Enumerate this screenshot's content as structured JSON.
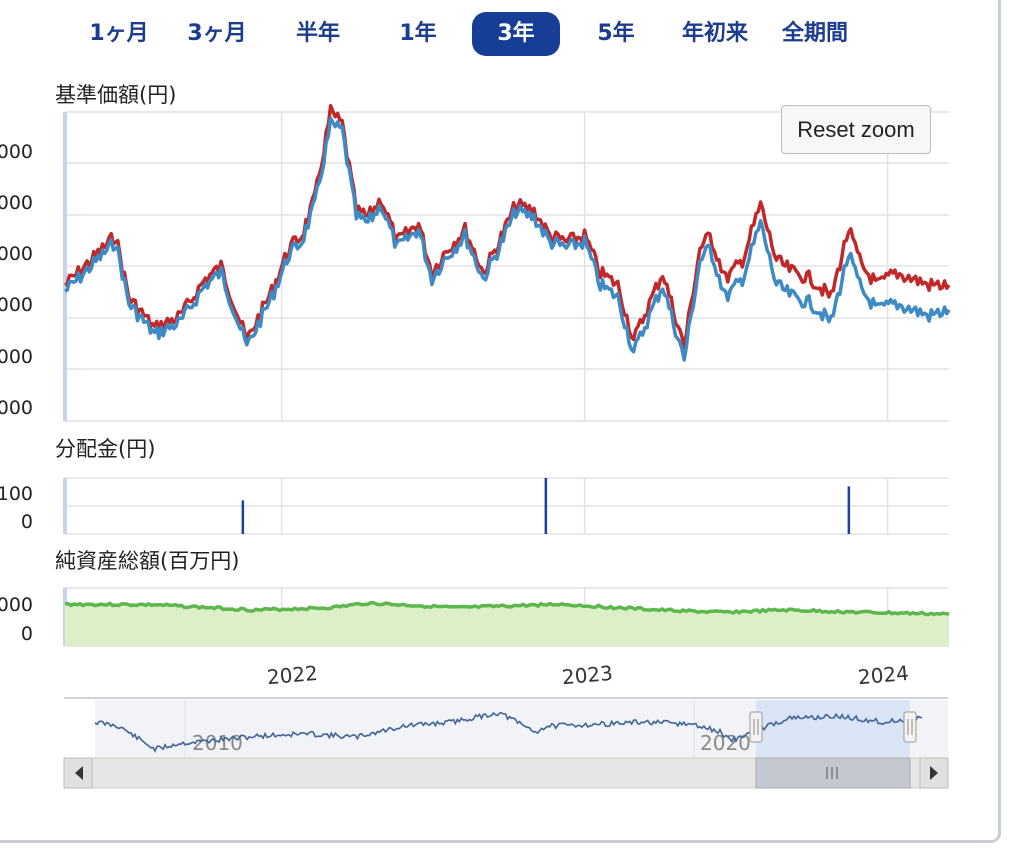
{
  "tabs": {
    "items": [
      "1ヶ月",
      "3ヶ月",
      "半年",
      "1年",
      "3年",
      "5年",
      "年初来",
      "全期間"
    ],
    "active": "3年"
  },
  "reset_zoom_label": "Reset zoom",
  "colors": {
    "price_red": "#c0282a",
    "price_blue": "#3d8ac5",
    "dividend_bar": "#1c3fa0",
    "assets_line": "#5cb84c",
    "assets_fill": "#dcefc8",
    "navigator_line": "#3f6596",
    "navigator_selection": "#d3e0f5",
    "tab_active": "#173e96",
    "tab_text": "#1b3c8f"
  },
  "chart_data": [
    {
      "type": "line",
      "title": "基準価額(円)",
      "y_tick_labels": [
        "000",
        "000",
        "000",
        "000",
        "000",
        "000"
      ],
      "x_tick_labels": [
        "2022",
        "2023",
        "2024"
      ],
      "x_tick_dates": [
        "2022-01-01",
        "2023-01-01",
        "2024-01-01"
      ],
      "x_range": [
        "2021-04-15",
        "2024-03-15"
      ],
      "ylim": [
        0,
        5
      ],
      "grid": true,
      "series": [
        {
          "color": "#c0282a",
          "x": [
            "2021-04-15",
            "2021-05-01",
            "2021-06-15",
            "2021-07-01",
            "2021-08-01",
            "2021-09-01",
            "2021-10-01",
            "2021-10-20",
            "2021-11-20",
            "2021-12-20",
            "2022-01-10",
            "2022-01-25",
            "2022-02-10",
            "2022-03-01",
            "2022-03-15",
            "2022-04-01",
            "2022-04-15",
            "2022-05-01",
            "2022-05-20",
            "2022-06-15",
            "2022-07-01",
            "2022-07-15",
            "2022-08-10",
            "2022-09-01",
            "2022-09-20",
            "2022-10-10",
            "2022-11-01",
            "2022-11-20",
            "2022-12-10",
            "2023-01-01",
            "2023-01-20",
            "2023-02-10",
            "2023-03-01",
            "2023-03-20",
            "2023-04-05",
            "2023-05-01",
            "2023-05-20",
            "2023-06-01",
            "2023-06-20",
            "2023-07-10",
            "2023-08-01",
            "2023-08-20",
            "2023-09-10",
            "2023-10-01",
            "2023-10-25",
            "2023-11-15",
            "2023-12-01",
            "2023-12-20",
            "2024-01-10",
            "2024-02-01",
            "2024-02-20",
            "2024-03-15"
          ],
          "values": [
            2.2,
            2.4,
            3.0,
            2.0,
            1.5,
            1.7,
            2.3,
            2.5,
            1.3,
            2.1,
            2.8,
            3.0,
            3.6,
            5.0,
            4.8,
            3.4,
            3.3,
            3.6,
            2.9,
            3.2,
            2.4,
            2.7,
            3.1,
            2.4,
            2.9,
            3.5,
            3.4,
            3.0,
            2.9,
            3.0,
            2.4,
            2.2,
            1.3,
            1.9,
            2.4,
            1.2,
            2.8,
            3.0,
            2.3,
            2.6,
            3.5,
            2.6,
            2.4,
            2.3,
            2.0,
            3.1,
            2.5,
            2.2,
            2.4,
            2.3,
            2.2,
            2.2
          ]
        },
        {
          "color": "#3d8ac5",
          "x": [
            "2021-04-15",
            "2021-05-01",
            "2021-06-15",
            "2021-07-01",
            "2021-08-01",
            "2021-09-01",
            "2021-10-01",
            "2021-10-20",
            "2021-11-20",
            "2021-12-20",
            "2022-01-10",
            "2022-01-25",
            "2022-02-10",
            "2022-03-01",
            "2022-03-15",
            "2022-04-01",
            "2022-04-15",
            "2022-05-01",
            "2022-05-20",
            "2022-06-15",
            "2022-07-01",
            "2022-07-15",
            "2022-08-10",
            "2022-09-01",
            "2022-09-20",
            "2022-10-10",
            "2022-11-01",
            "2022-11-20",
            "2022-12-10",
            "2023-01-01",
            "2023-01-20",
            "2023-02-10",
            "2023-03-01",
            "2023-03-20",
            "2023-04-05",
            "2023-05-01",
            "2023-05-20",
            "2023-06-01",
            "2023-06-20",
            "2023-07-10",
            "2023-08-01",
            "2023-08-20",
            "2023-09-10",
            "2023-10-01",
            "2023-10-25",
            "2023-11-15",
            "2023-12-01",
            "2023-12-20",
            "2024-01-10",
            "2024-02-01",
            "2024-02-20",
            "2024-03-15"
          ],
          "values": [
            2.1,
            2.3,
            2.9,
            1.9,
            1.4,
            1.6,
            2.2,
            2.4,
            1.2,
            2.0,
            2.7,
            2.9,
            3.5,
            4.8,
            4.7,
            3.3,
            3.2,
            3.5,
            2.8,
            3.1,
            2.3,
            2.6,
            3.0,
            2.3,
            2.8,
            3.4,
            3.3,
            2.9,
            2.8,
            2.9,
            2.2,
            2.0,
            1.1,
            1.7,
            2.2,
            1.0,
            2.6,
            2.8,
            2.0,
            2.3,
            3.2,
            2.2,
            2.0,
            1.9,
            1.6,
            2.7,
            2.1,
            1.8,
            1.9,
            1.8,
            1.7,
            1.8
          ]
        }
      ]
    },
    {
      "type": "bar",
      "title": "分配金(円)",
      "y_tick_labels": [
        "100",
        "0"
      ],
      "ylim": [
        0,
        100
      ],
      "grid": true,
      "x": [
        "2021-11-15",
        "2022-11-15",
        "2023-11-15"
      ],
      "values": [
        60,
        100,
        85
      ]
    },
    {
      "type": "area",
      "title": "純資産総額(百万円)",
      "y_tick_labels": [
        "000",
        "0"
      ],
      "ylim": [
        0,
        1
      ],
      "grid": true,
      "x": [
        "2021-04-15",
        "2021-08-01",
        "2021-12-01",
        "2022-03-01",
        "2022-04-15",
        "2022-08-01",
        "2022-12-01",
        "2023-04-01",
        "2023-06-15",
        "2023-09-01",
        "2023-12-01",
        "2024-03-15"
      ],
      "values": [
        0.72,
        0.71,
        0.62,
        0.66,
        0.74,
        0.66,
        0.72,
        0.62,
        0.58,
        0.62,
        0.58,
        0.55
      ]
    },
    {
      "type": "area",
      "title": "",
      "x_tick_labels": [
        "2010",
        "2020"
      ],
      "x_tick_dates": [
        "2010-01-01",
        "2020-01-01"
      ],
      "x_range": [
        "2007-01-01",
        "2024-03-15"
      ],
      "ylim": [
        0,
        1
      ],
      "selection": [
        "2021-03-15",
        "2024-03-15"
      ],
      "x": [
        "2007-01-01",
        "2007-07-01",
        "2008-04-01",
        "2008-10-01",
        "2009-06-01",
        "2010-06-01",
        "2011-06-01",
        "2012-06-01",
        "2013-06-01",
        "2014-06-01",
        "2015-06-01",
        "2016-03-01",
        "2016-06-01",
        "2017-06-01",
        "2018-06-01",
        "2019-06-01",
        "2020-01-01",
        "2020-04-01",
        "2020-10-01",
        "2021-06-01",
        "2022-06-01",
        "2023-06-01",
        "2024-03-15"
      ],
      "values": [
        0.62,
        0.55,
        0.15,
        0.25,
        0.3,
        0.38,
        0.42,
        0.36,
        0.55,
        0.62,
        0.78,
        0.45,
        0.55,
        0.58,
        0.62,
        0.58,
        0.45,
        0.3,
        0.48,
        0.68,
        0.72,
        0.62,
        0.7
      ]
    }
  ]
}
